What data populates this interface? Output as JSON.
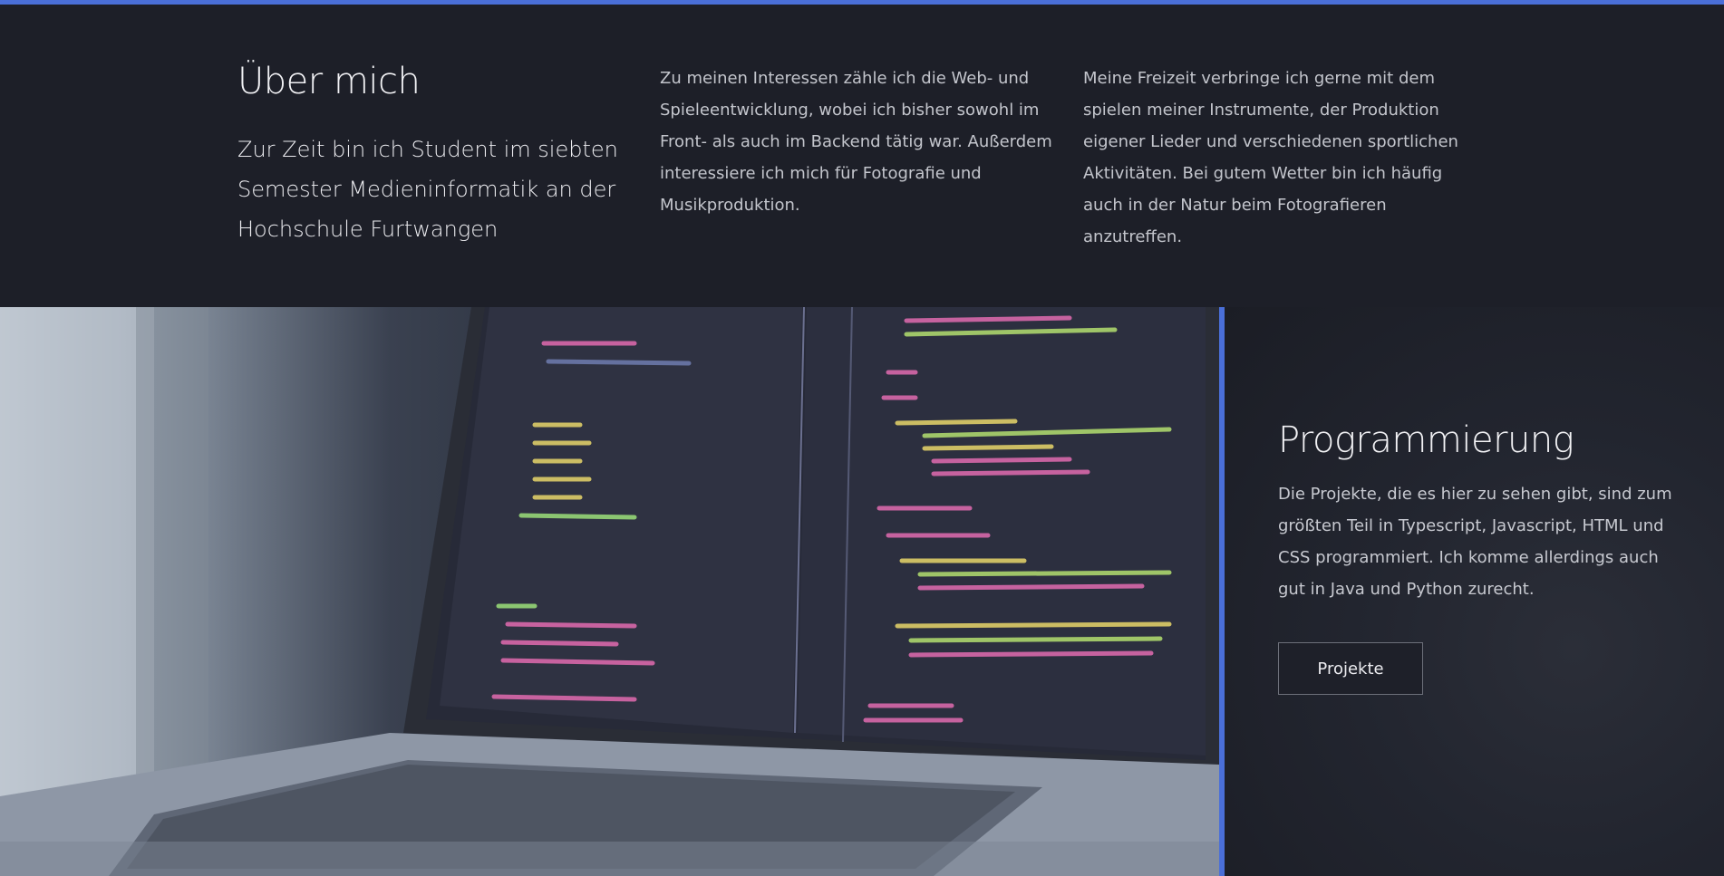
{
  "about": {
    "title": "Über mich",
    "lead": "Zur Zeit bin ich Student im siebten Semester Medieninformatik an der Hochschule Furtwangen",
    "interests": "Zu meinen Interessen zähle ich die Web- und Spieleentwicklung, wobei ich bisher sowohl im Front- als auch im Backend tätig war. Außerdem interessiere ich mich für Fotografie und Musikproduktion.",
    "freetime": "Meine Freizeit verbringe ich gerne mit dem spielen meiner Instrumente, der Produktion eigener Lieder und verschiedenen sportlichen Aktivitäten. Bei gutem Wetter bin ich häufig auch in der Natur beim Fotografieren anzutreffen."
  },
  "programming": {
    "title": "Programmierung",
    "text": "Die Projekte, die es hier zu sehen gibt, sind zum größten Teil in Typescript, Javascript, HTML und CSS programmiert. Ich komme allerdings auch gut in Java und Python zurecht.",
    "button_label": "Projekte"
  },
  "colors": {
    "accent": "#4a6fd8",
    "background": "#1d1f28"
  },
  "icons": {
    "photo": "laptop-code-photo"
  }
}
